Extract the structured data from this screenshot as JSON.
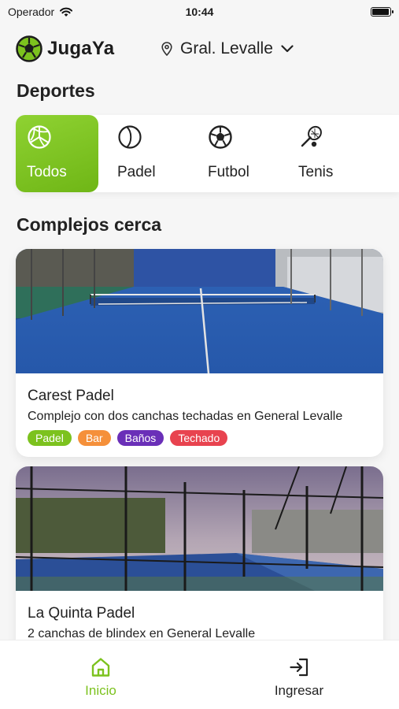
{
  "status_bar": {
    "carrier": "Operador",
    "time": "10:44",
    "battery_level": 0.95
  },
  "header": {
    "app_name": "JugaYa",
    "location": "Gral. Levalle"
  },
  "sections": {
    "sports_title": "Deportes",
    "nearby_title": "Complejos cerca"
  },
  "sports": [
    {
      "label": "Todos",
      "icon": "volleyball-icon",
      "active": true
    },
    {
      "label": "Padel",
      "icon": "padel-ball-icon",
      "active": false
    },
    {
      "label": "Futbol",
      "icon": "soccer-ball-icon",
      "active": false
    },
    {
      "label": "Tenis",
      "icon": "tennis-racket-icon",
      "active": false
    }
  ],
  "complexes": [
    {
      "name": "Carest Padel",
      "description": "Complejo con dos canchas techadas en General Levalle",
      "tags": [
        {
          "label": "Padel",
          "color": "#7cc21e"
        },
        {
          "label": "Bar",
          "color": "#f5903a"
        },
        {
          "label": "Baños",
          "color": "#6a2fb8"
        },
        {
          "label": "Techado",
          "color": "#e8434f"
        }
      ]
    },
    {
      "name": "La Quinta Padel",
      "description": "2 canchas de blindex en General Levalle",
      "tags": []
    }
  ],
  "tab_bar": {
    "home_label": "Inicio",
    "login_label": "Ingresar",
    "active_color": "#7cc21e"
  },
  "colors": {
    "accent": "#7cc21e",
    "text": "#222222",
    "background": "#f6f6f6"
  }
}
